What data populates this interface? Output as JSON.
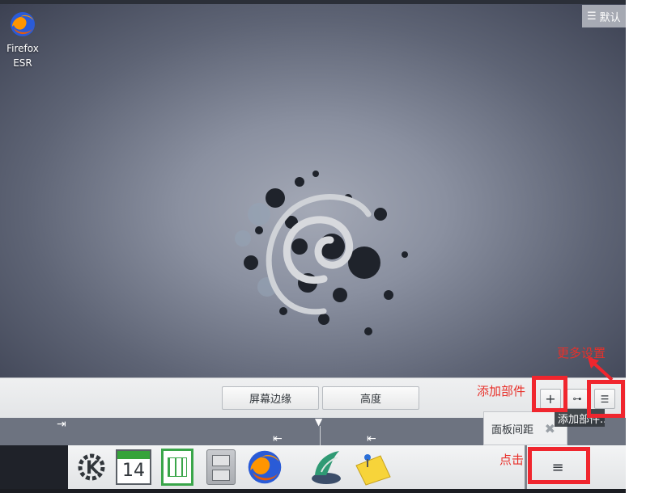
{
  "desktop": {
    "icon_line1": "Firefox",
    "icon_line2": "ESR",
    "top_right_label": "默认"
  },
  "config": {
    "screen_edge": "屏幕边缘",
    "height": "高度"
  },
  "tooltip": "添加部件...",
  "spacing_popup": "面板间距",
  "taskbar": {
    "calendar_day": "14"
  },
  "annotations": {
    "more_settings": "更多设置",
    "add_widget": "添加部件",
    "click": "点击"
  }
}
